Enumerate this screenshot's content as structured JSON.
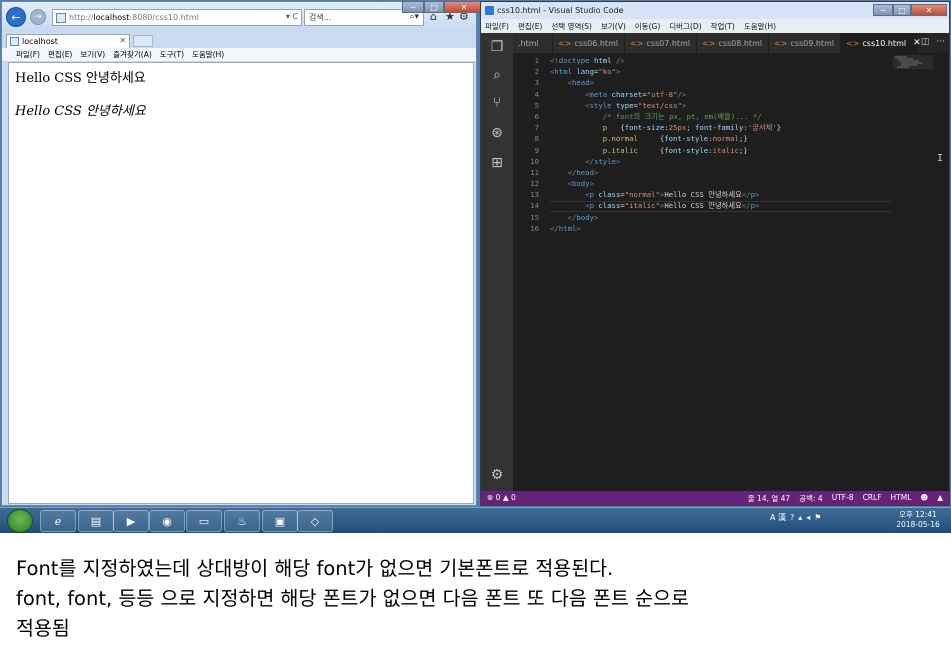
{
  "ie": {
    "address_prefix": "http://",
    "address_host": "localhost",
    "address_rest": ":8080/css10.html",
    "address_buttons": "▾ C",
    "search_placeholder": "검색...",
    "tab_title": "localhost",
    "menu": [
      "파일(F)",
      "편집(E)",
      "보기(V)",
      "즐겨찾기(A)",
      "도구(T)",
      "도움말(H)"
    ],
    "content": {
      "normal_text": "Hello CSS 안녕하세요",
      "italic_text": "Hello CSS 안녕하세요"
    }
  },
  "vscode": {
    "title": "css10.html - Visual Studio Code",
    "menu": [
      "파일(F)",
      "편집(E)",
      "선택 영역(S)",
      "보기(V)",
      "이동(G)",
      "디버그(D)",
      "작업(T)",
      "도움말(H)"
    ],
    "tabs": [
      {
        "label": ".html",
        "active": false
      },
      {
        "label": "css06.html",
        "active": false
      },
      {
        "label": "css07.html",
        "active": false
      },
      {
        "label": "css08.html",
        "active": false
      },
      {
        "label": "css09.html",
        "active": false
      },
      {
        "label": "css10.html",
        "active": true
      }
    ],
    "code_lines": [
      "1",
      "2",
      "3",
      "4",
      "5",
      "6",
      "7",
      "8",
      "9",
      "10",
      "11",
      "12",
      "13",
      "14",
      "15",
      "16"
    ],
    "status": {
      "left": "⊗ 0 ▲ 0",
      "position": "줄 14, 열 47",
      "spaces": "공백: 4",
      "encoding": "UTF-8",
      "eol": "CRLF",
      "language": "HTML"
    }
  },
  "taskbar": {
    "ime": "A 漢",
    "clock_time": "오후 12:41",
    "clock_date": "2018-05-16"
  },
  "caption": {
    "line1": "Font를 지정하였는데 상대방이 해당 font가 없으면 기본폰트로 적용된다.",
    "line2": "font, font, 등등 으로 지정하면 해당 폰트가 없으면 다음 폰트 또 다음 폰트 순으로",
    "line3": "적용됨"
  }
}
